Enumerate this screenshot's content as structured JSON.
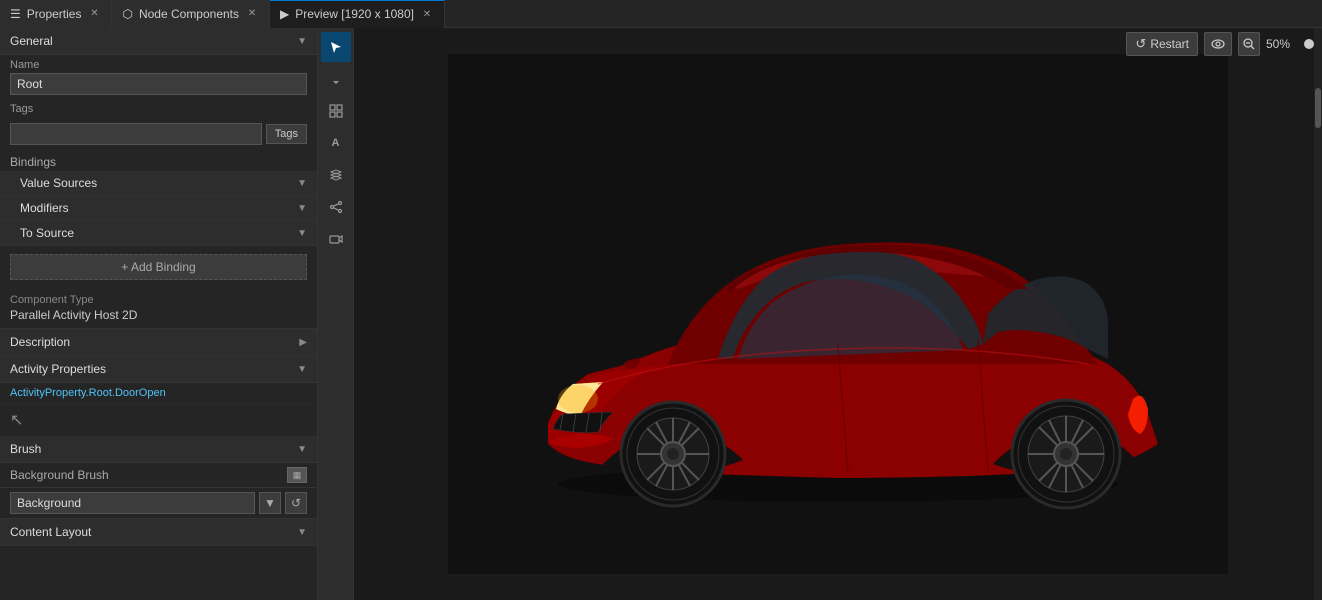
{
  "tabs": [
    {
      "id": "properties",
      "label": "Properties",
      "icon": "list-icon",
      "active": false,
      "closable": true
    },
    {
      "id": "node-components",
      "label": "Node Components",
      "icon": "node-icon",
      "active": false,
      "closable": true
    },
    {
      "id": "preview",
      "label": "Preview [1920 x 1080]",
      "icon": "play-icon",
      "active": true,
      "closable": true
    }
  ],
  "left_panel": {
    "general_section": {
      "title": "General",
      "collapsed": false,
      "name_label": "Name",
      "name_value": "Root",
      "tags_label": "Tags",
      "tags_button": "Tags"
    },
    "bindings_label": "Bindings",
    "value_sources": {
      "title": "Value Sources",
      "collapsed": false
    },
    "modifiers": {
      "title": "Modifiers",
      "collapsed": false
    },
    "to_source": {
      "title": "To Source",
      "collapsed": false
    },
    "add_binding_label": "+ Add Binding",
    "component_type_label": "Component Type",
    "component_type_value": "Parallel Activity Host 2D",
    "description_section": {
      "title": "Description",
      "has_right_arrow": true
    },
    "activity_properties": {
      "title": "Activity Properties",
      "collapsed": false,
      "value": "ActivityProperty.Root.DoorOpen"
    },
    "brush_section": {
      "title": "Brush",
      "collapsed": false
    },
    "background_brush_label": "Background Brush",
    "background_dropdown_value": "Background",
    "content_layout": {
      "title": "Content Layout",
      "collapsed": false
    }
  },
  "toolbar_tools": [
    {
      "id": "select-cursor",
      "icon": "↖",
      "active": true,
      "tooltip": "Select"
    },
    {
      "id": "arrow-tool",
      "icon": "↑",
      "active": false,
      "tooltip": "Arrow"
    },
    {
      "id": "grid-tool",
      "icon": "⊞",
      "active": false,
      "tooltip": "Grid"
    },
    {
      "id": "text-tool",
      "icon": "A",
      "active": false,
      "tooltip": "Text"
    },
    {
      "id": "layers-tool",
      "icon": "◧",
      "active": false,
      "tooltip": "Layers"
    },
    {
      "id": "share-tool",
      "icon": "⟳",
      "active": false,
      "tooltip": "Share"
    },
    {
      "id": "camera-tool",
      "icon": "🎥",
      "active": false,
      "tooltip": "Camera"
    }
  ],
  "preview": {
    "title": "Preview [1920 x 1080]",
    "restart_label": "Restart",
    "zoom_value": "50%",
    "eye_icon": "👁"
  }
}
